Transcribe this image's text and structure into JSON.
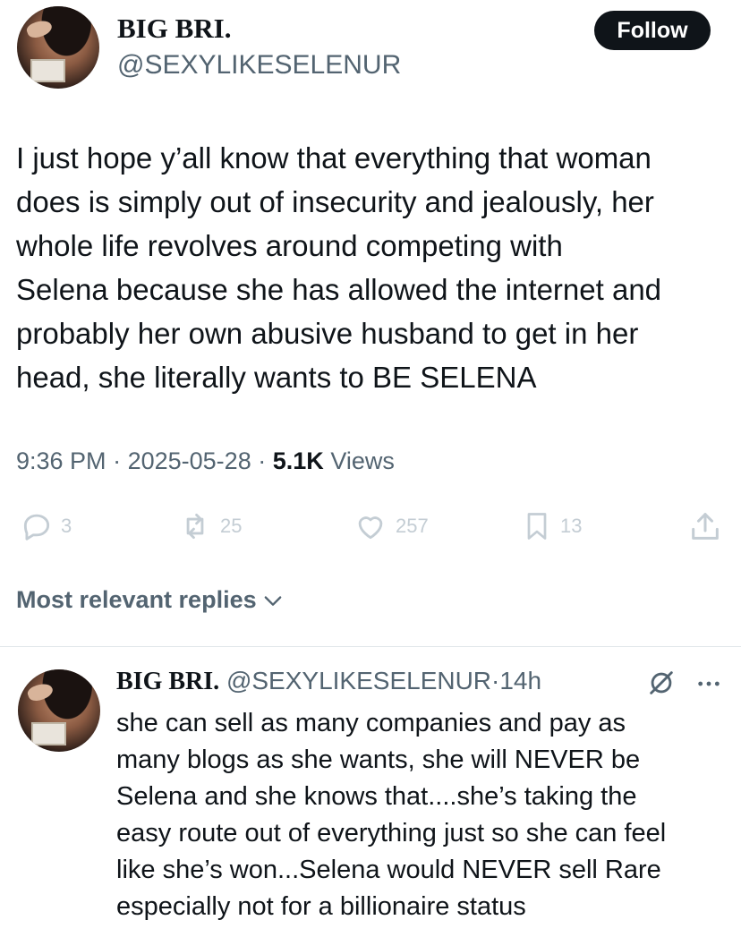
{
  "tweet": {
    "author_name": "BIG BRI.",
    "author_handle": "@SEXYLIKESELENUR",
    "follow_label": "Follow",
    "text": "I just hope y’all know that everything that woman\ndoes is simply out of insecurity and jealously, her\nwhole life revolves around competing with\nSelena because she has allowed the internet and\nprobably her own abusive husband to get in her\nhead, she literally wants to BE SELENA",
    "time": "9:36 PM",
    "date": "2025-05-28",
    "views_count": "5.1K",
    "views_label": "Views",
    "separator": "·"
  },
  "actions": {
    "replies": "3",
    "reposts": "25",
    "likes": "257",
    "bookmarks": "13"
  },
  "replies_section": {
    "label": "Most relevant replies"
  },
  "reply": {
    "author_name": "BIG BRI.",
    "author_handle": "@SEXYLIKESELENUR",
    "separator": "·",
    "time_ago": "14h",
    "text": "she can sell as many companies and pay as\nmany blogs as she wants, she will NEVER be\nSelena and she knows that....she’s taking the\neasy route out of everything just so she can feel\nlike she’s won...Selena would NEVER sell Rare\nespecially not for a billionaire status"
  },
  "icons": {
    "reply": "reply-icon",
    "repost": "repost-icon",
    "like": "heart-icon",
    "bookmark": "bookmark-icon",
    "share": "share-icon",
    "chevron": "chevron-down-icon",
    "grok": "grok-icon",
    "more": "more-icon"
  },
  "colors": {
    "text": "#0f1419",
    "secondary": "#536471",
    "action_faded": "#c4cdd4",
    "button_bg": "#0f1419"
  }
}
